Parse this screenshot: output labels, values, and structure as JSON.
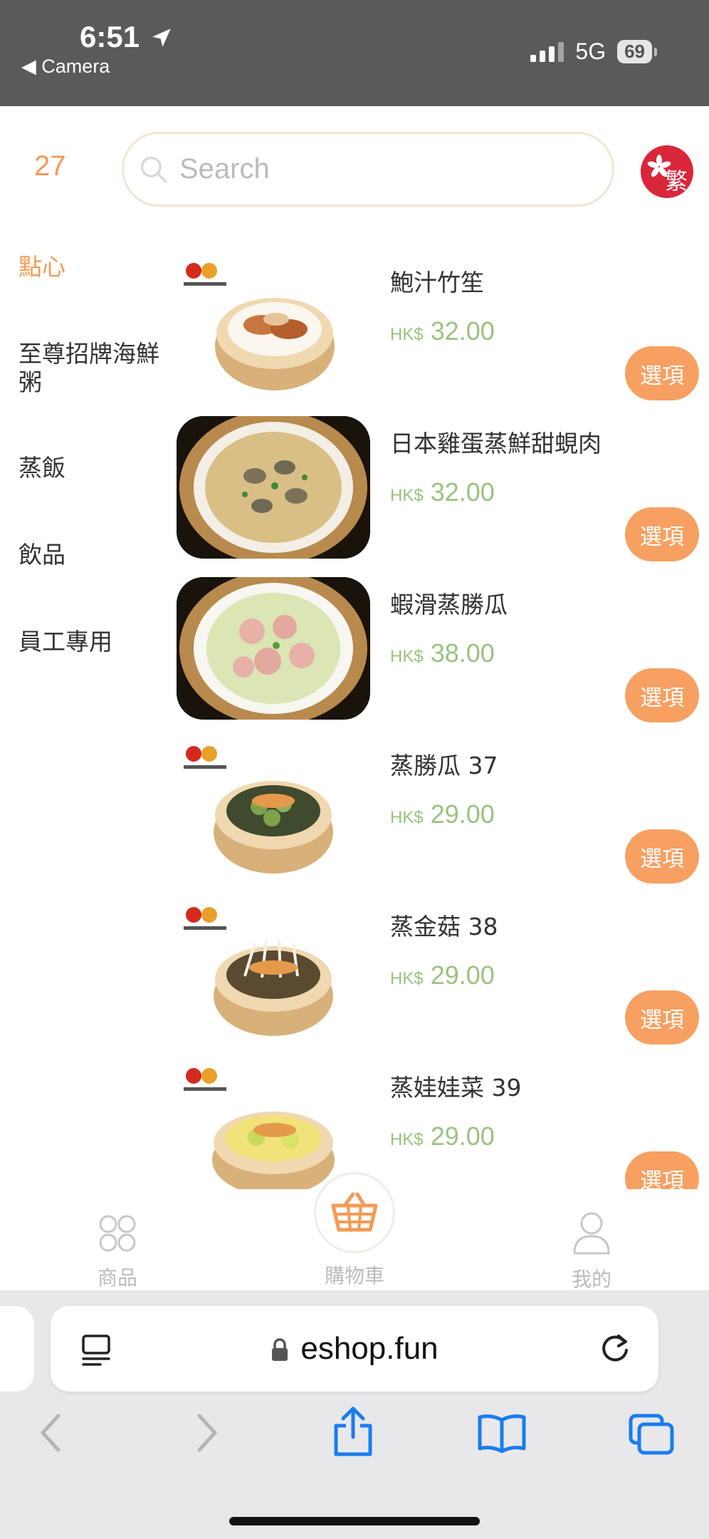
{
  "status_bar": {
    "time": "6:51",
    "back_app": "◀ Camera",
    "network": "5G",
    "battery": "69"
  },
  "header": {
    "cart_count": "27",
    "search_placeholder": "Search",
    "language_label": "繁"
  },
  "sidebar": {
    "categories": [
      {
        "label": "點心",
        "active": true
      },
      {
        "label": "至尊招牌海鮮粥",
        "active": false
      },
      {
        "label": "蒸飯",
        "active": false
      },
      {
        "label": "飲品",
        "active": false
      },
      {
        "label": "員工專用",
        "active": false
      }
    ]
  },
  "products": [
    {
      "name": "鮑汁竹笙",
      "currency": "HK$",
      "price": "32.00",
      "button": "選項",
      "image": "steamer-bamboo-pith"
    },
    {
      "name": "日本雞蛋蒸鮮甜蜆肉",
      "currency": "HK$",
      "price": "32.00",
      "button": "選項",
      "image": "steamed-egg-clams"
    },
    {
      "name": "蝦滑蒸勝瓜",
      "currency": "HK$",
      "price": "38.00",
      "button": "選項",
      "image": "shrimp-paste-luffa"
    },
    {
      "name": "蒸勝瓜 37",
      "currency": "HK$",
      "price": "29.00",
      "button": "選項",
      "image": "steamer-luffa"
    },
    {
      "name": "蒸金菇 38",
      "currency": "HK$",
      "price": "29.00",
      "button": "選項",
      "image": "steamer-enoki"
    },
    {
      "name": "蒸娃娃菜 39",
      "currency": "HK$",
      "price": "29.00",
      "button": "選項",
      "image": "steamer-baby-cabbage"
    }
  ],
  "tab_bar": {
    "products_label": "商品",
    "cart_label": "購物車",
    "me_label": "我的"
  },
  "browser": {
    "url": "eshop.fun"
  },
  "colors": {
    "accent": "#f59a55",
    "price": "#9bc27e",
    "status_bar_bg": "#5a5a5a",
    "lang_badge": "#d9263a"
  }
}
